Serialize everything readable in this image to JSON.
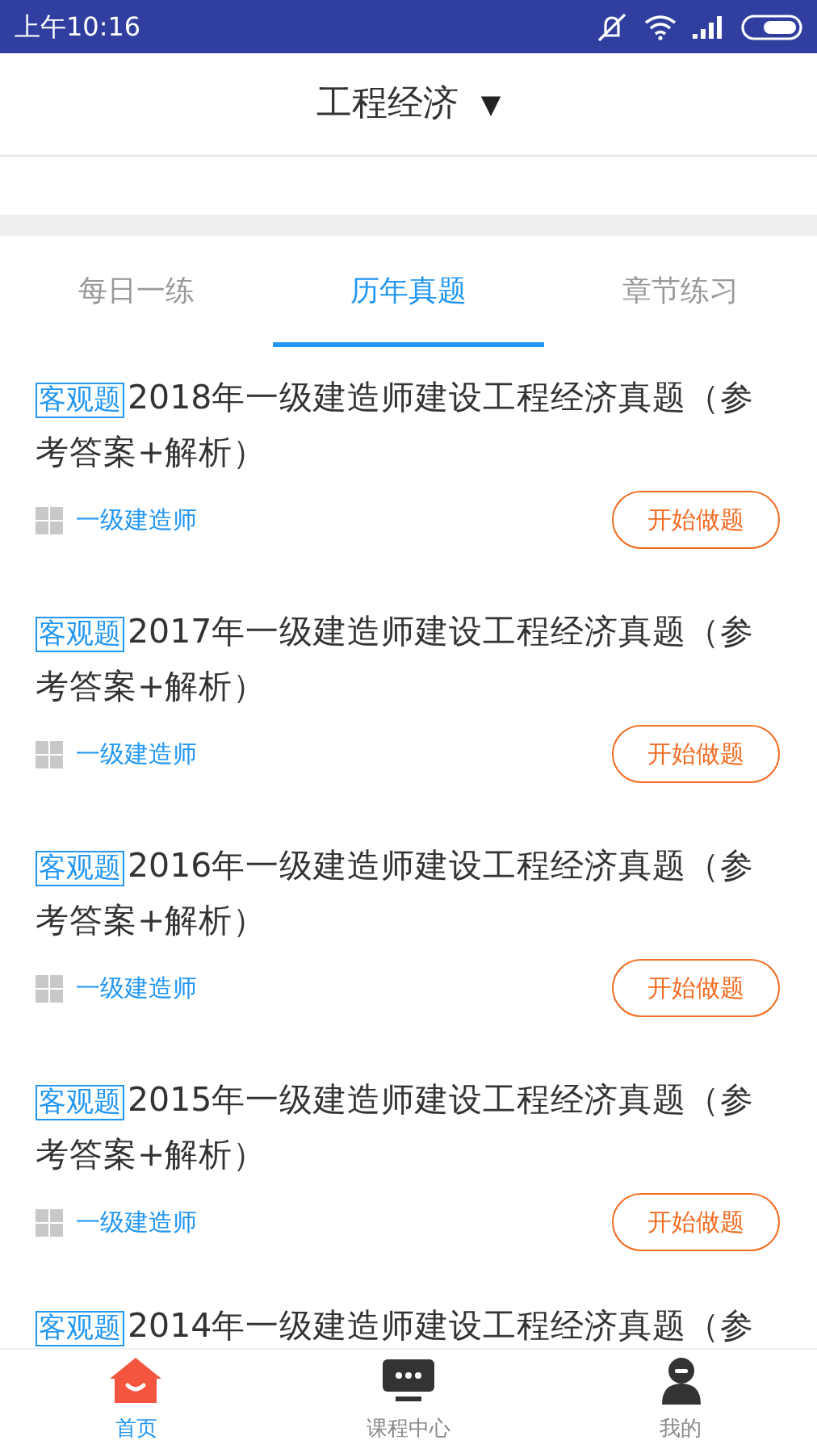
{
  "status_bar": {
    "time": "上午10:16"
  },
  "header": {
    "title": "工程经济",
    "dropdown": "▼"
  },
  "tabs": [
    {
      "label": "每日一练",
      "selected": false
    },
    {
      "label": "历年真题",
      "selected": true
    },
    {
      "label": "章节练习",
      "selected": false
    }
  ],
  "papers": [
    {
      "tag": "客观题",
      "title": "2018年一级建造师建设工程经济真题（参考答案+解析）",
      "category": "一级建造师",
      "button": "开始做题"
    },
    {
      "tag": "客观题",
      "title": "2017年一级建造师建设工程经济真题（参考答案+解析）",
      "category": "一级建造师",
      "button": "开始做题"
    },
    {
      "tag": "客观题",
      "title": "2016年一级建造师建设工程经济真题（参考答案+解析）",
      "category": "一级建造师",
      "button": "开始做题"
    },
    {
      "tag": "客观题",
      "title": "2015年一级建造师建设工程经济真题（参考答案+解析）",
      "category": "一级建造师",
      "button": "开始做题"
    },
    {
      "tag": "客观题",
      "title": "2014年一级建造师建设工程经济真题（参"
    }
  ],
  "bottom_nav": [
    {
      "kind": "home",
      "label": "首页",
      "selected": true
    },
    {
      "kind": "course",
      "label": "课程中心",
      "selected": false
    },
    {
      "kind": "profile",
      "label": "我的",
      "selected": false
    }
  ]
}
